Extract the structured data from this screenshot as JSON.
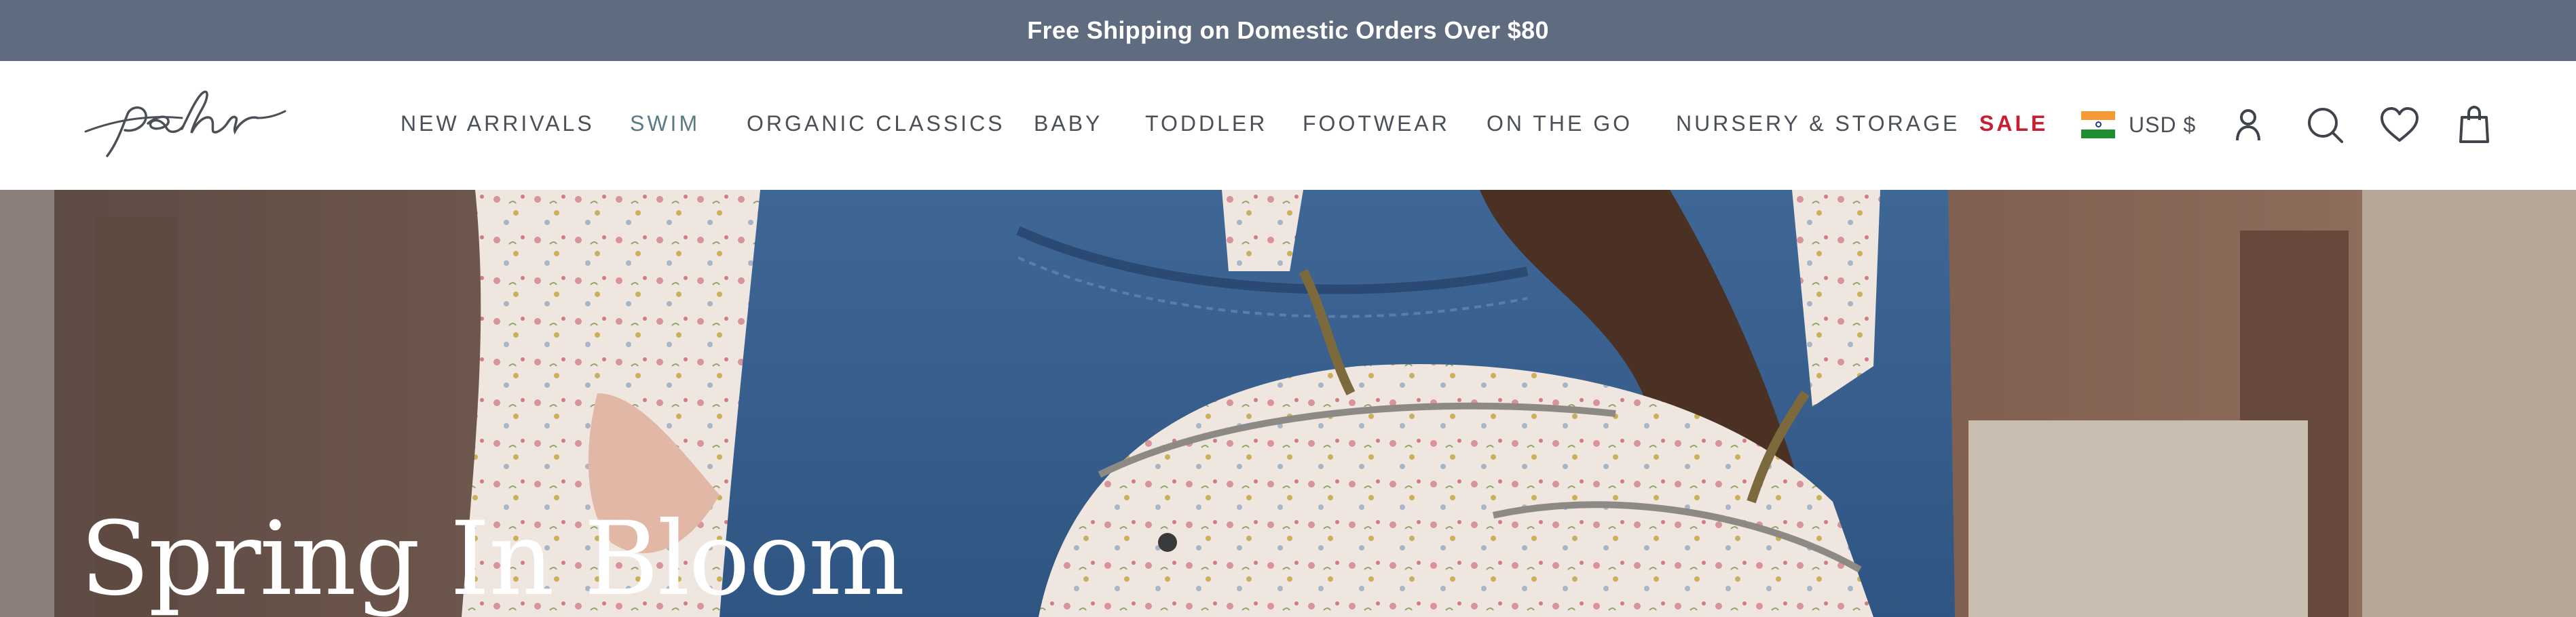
{
  "announcement": {
    "text": "Free Shipping on Domestic Orders Over $80"
  },
  "brand": {
    "logo_text": "pehr"
  },
  "nav": {
    "items": [
      {
        "label": "NEW ARRIVALS"
      },
      {
        "label": "SWIM"
      },
      {
        "label": "ORGANIC CLASSICS"
      },
      {
        "label": "BABY"
      },
      {
        "label": "TODDLER"
      },
      {
        "label": "FOOTWEAR"
      },
      {
        "label": "ON THE GO"
      },
      {
        "label": "NURSERY & STORAGE"
      },
      {
        "label": "SALE"
      }
    ]
  },
  "header_actions": {
    "currency_label": "USD $",
    "currency_flag": "india-flag-icon",
    "icons": [
      "account-icon",
      "search-icon",
      "wishlist-heart-icon",
      "cart-bag-icon"
    ]
  },
  "hero": {
    "title": "Spring In Bloom"
  },
  "colors": {
    "announcement_bg": "#5f6b7f",
    "nav_text": "#4b4f58",
    "swim_accent": "#5b7b83",
    "sale_red": "#c42032"
  }
}
